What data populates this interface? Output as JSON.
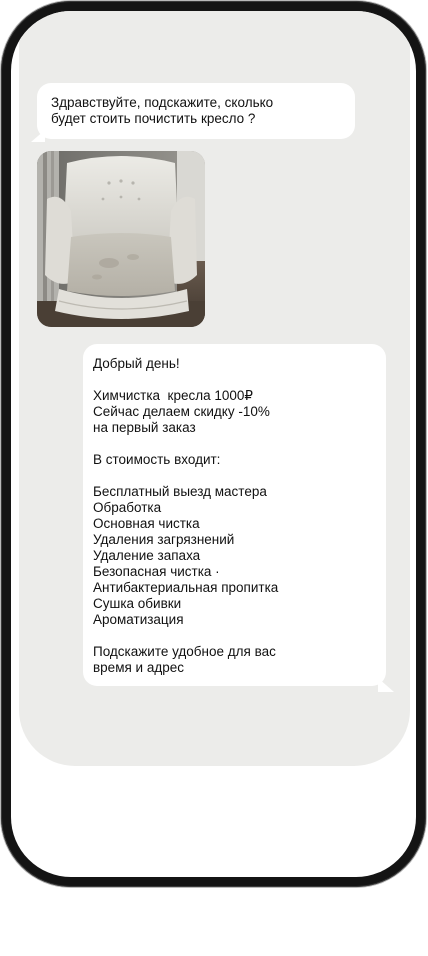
{
  "messages": [
    {
      "sender": "customer",
      "lines": [
        "Здравствуйте, подскажите, сколько",
        "будет стоить почистить кресло ?"
      ]
    },
    {
      "sender": "service",
      "lines": [
        "Добрый день!",
        "",
        "Химчистка  кресла 1000₽",
        "Сейчас делаем скидку -10%",
        "на первый заказ",
        "",
        "В стоимость входит:",
        "",
        "Бесплатный выезд мастера",
        "Обработка",
        "Основная чистка",
        "Удаления загрязнений",
        "Удаление запаха",
        "Безопасная чистка ·",
        "Антибактериальная пропитка",
        "Сушка обивки",
        "Ароматизация",
        "",
        "Подскажите удобное для вас",
        "время и адрес"
      ]
    }
  ],
  "colors": {
    "chat_background": "#ececea",
    "bubble": "#ffffff",
    "frame": "#141414"
  }
}
